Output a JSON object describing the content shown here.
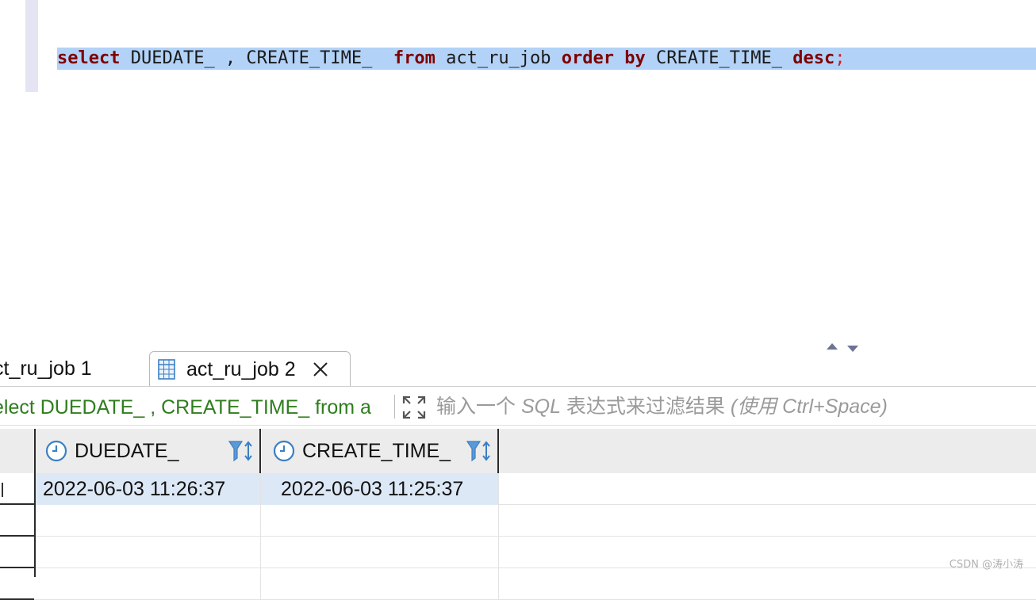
{
  "editor": {
    "tokens": [
      {
        "text": "select",
        "kind": "kw"
      },
      {
        "text": " DUEDATE_ , CREATE_TIME_  ",
        "kind": "plain"
      },
      {
        "text": "from",
        "kind": "kw"
      },
      {
        "text": " act_ru_job ",
        "kind": "plain"
      },
      {
        "text": "order",
        "kind": "kw"
      },
      {
        "text": " ",
        "kind": "plain"
      },
      {
        "text": "by",
        "kind": "kw"
      },
      {
        "text": " CREATE_TIME_ ",
        "kind": "plain"
      },
      {
        "text": "desc",
        "kind": "kw"
      },
      {
        "text": ";",
        "kind": "semi"
      }
    ]
  },
  "tabs": [
    {
      "label": "ct_ru_job 1",
      "icon": "table-grid-icon",
      "active": false
    },
    {
      "label": "act_ru_job 2",
      "icon": "table-grid-icon",
      "active": true,
      "close_icon": "close-icon"
    }
  ],
  "filter": {
    "query_text": "elect DUEDATE_ , CREATE_TIME_ from a",
    "expand_icon": "expand-icon",
    "placeholder_a": "输入一个 ",
    "placeholder_b": "SQL",
    "placeholder_c": " 表达式来过滤结果 ",
    "placeholder_d": "(使用 Ctrl+Space)"
  },
  "grid": {
    "columns": [
      {
        "label": "DUEDATE_",
        "icon": "clock-icon",
        "sort_icon": "filter-sort-icon"
      },
      {
        "label": "CREATE_TIME_",
        "icon": "clock-icon",
        "sort_icon": "filter-sort-icon"
      }
    ],
    "rows": [
      [
        "2022-06-03 11:26:37",
        "2022-06-03 11:25:37"
      ],
      [
        "",
        ""
      ],
      [
        "",
        ""
      ],
      [
        "",
        ""
      ]
    ]
  },
  "watermark": "CSDN @涛小涛",
  "colors": {
    "keyword": "#7f0000",
    "selection": "#b3d2f7",
    "filter_query": "#2f7d1e",
    "icon_blue": "#3b7fc4"
  }
}
